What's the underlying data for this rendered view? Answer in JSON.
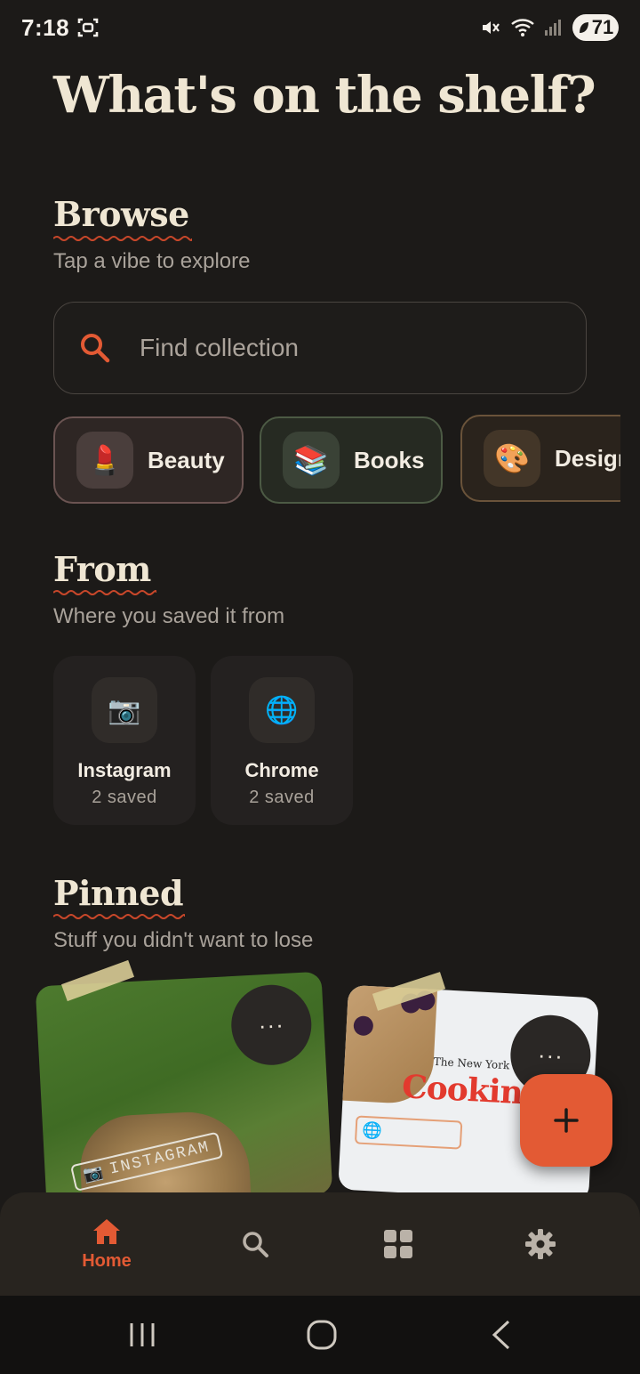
{
  "status_bar": {
    "time": "7:18",
    "battery": "71"
  },
  "page": {
    "title": "What's on the shelf?"
  },
  "browse": {
    "title": "Browse",
    "subtitle": "Tap a vibe to explore",
    "search_placeholder": "Find collection",
    "chips": [
      {
        "label": "Beauty",
        "emoji": "💄"
      },
      {
        "label": "Books",
        "emoji": "📚"
      },
      {
        "label": "Design",
        "emoji": "🎨"
      }
    ]
  },
  "from": {
    "title": "From",
    "subtitle": "Where you saved it from",
    "sources": [
      {
        "name": "Instagram",
        "count": "2 saved",
        "emoji": "📷"
      },
      {
        "name": "Chrome",
        "count": "2 saved",
        "emoji": "🌐"
      }
    ]
  },
  "pinned": {
    "title": "Pinned",
    "subtitle": "Stuff you didn't want to lose",
    "cards": [
      {
        "stamp": "INSTAGRAM",
        "more": "···"
      },
      {
        "publisher": "The New York Times",
        "headline": "Cooking",
        "more": "···"
      }
    ]
  },
  "fab": {
    "icon": "plus-icon"
  },
  "bottom_nav": {
    "items": [
      {
        "label": "Home",
        "icon": "home-icon",
        "active": true
      },
      {
        "label": "",
        "icon": "search-icon"
      },
      {
        "label": "",
        "icon": "grid-icon"
      },
      {
        "label": "",
        "icon": "gear-icon"
      }
    ]
  },
  "colors": {
    "accent": "#e35a34",
    "background": "#1c1a18",
    "text": "#ece4d6"
  }
}
